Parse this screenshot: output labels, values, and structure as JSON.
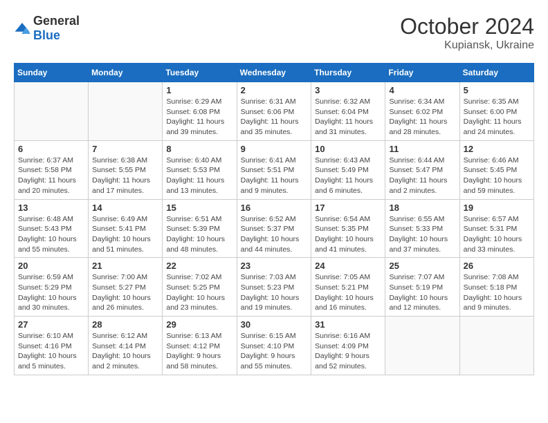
{
  "header": {
    "logo": {
      "general": "General",
      "blue": "Blue"
    },
    "title": "October 2024",
    "location": "Kupiansk, Ukraine"
  },
  "weekdays": [
    "Sunday",
    "Monday",
    "Tuesday",
    "Wednesday",
    "Thursday",
    "Friday",
    "Saturday"
  ],
  "weeks": [
    [
      {
        "day": "",
        "info": ""
      },
      {
        "day": "",
        "info": ""
      },
      {
        "day": "1",
        "info": "Sunrise: 6:29 AM\nSunset: 6:08 PM\nDaylight: 11 hours and 39 minutes."
      },
      {
        "day": "2",
        "info": "Sunrise: 6:31 AM\nSunset: 6:06 PM\nDaylight: 11 hours and 35 minutes."
      },
      {
        "day": "3",
        "info": "Sunrise: 6:32 AM\nSunset: 6:04 PM\nDaylight: 11 hours and 31 minutes."
      },
      {
        "day": "4",
        "info": "Sunrise: 6:34 AM\nSunset: 6:02 PM\nDaylight: 11 hours and 28 minutes."
      },
      {
        "day": "5",
        "info": "Sunrise: 6:35 AM\nSunset: 6:00 PM\nDaylight: 11 hours and 24 minutes."
      }
    ],
    [
      {
        "day": "6",
        "info": "Sunrise: 6:37 AM\nSunset: 5:58 PM\nDaylight: 11 hours and 20 minutes."
      },
      {
        "day": "7",
        "info": "Sunrise: 6:38 AM\nSunset: 5:55 PM\nDaylight: 11 hours and 17 minutes."
      },
      {
        "day": "8",
        "info": "Sunrise: 6:40 AM\nSunset: 5:53 PM\nDaylight: 11 hours and 13 minutes."
      },
      {
        "day": "9",
        "info": "Sunrise: 6:41 AM\nSunset: 5:51 PM\nDaylight: 11 hours and 9 minutes."
      },
      {
        "day": "10",
        "info": "Sunrise: 6:43 AM\nSunset: 5:49 PM\nDaylight: 11 hours and 6 minutes."
      },
      {
        "day": "11",
        "info": "Sunrise: 6:44 AM\nSunset: 5:47 PM\nDaylight: 11 hours and 2 minutes."
      },
      {
        "day": "12",
        "info": "Sunrise: 6:46 AM\nSunset: 5:45 PM\nDaylight: 10 hours and 59 minutes."
      }
    ],
    [
      {
        "day": "13",
        "info": "Sunrise: 6:48 AM\nSunset: 5:43 PM\nDaylight: 10 hours and 55 minutes."
      },
      {
        "day": "14",
        "info": "Sunrise: 6:49 AM\nSunset: 5:41 PM\nDaylight: 10 hours and 51 minutes."
      },
      {
        "day": "15",
        "info": "Sunrise: 6:51 AM\nSunset: 5:39 PM\nDaylight: 10 hours and 48 minutes."
      },
      {
        "day": "16",
        "info": "Sunrise: 6:52 AM\nSunset: 5:37 PM\nDaylight: 10 hours and 44 minutes."
      },
      {
        "day": "17",
        "info": "Sunrise: 6:54 AM\nSunset: 5:35 PM\nDaylight: 10 hours and 41 minutes."
      },
      {
        "day": "18",
        "info": "Sunrise: 6:55 AM\nSunset: 5:33 PM\nDaylight: 10 hours and 37 minutes."
      },
      {
        "day": "19",
        "info": "Sunrise: 6:57 AM\nSunset: 5:31 PM\nDaylight: 10 hours and 33 minutes."
      }
    ],
    [
      {
        "day": "20",
        "info": "Sunrise: 6:59 AM\nSunset: 5:29 PM\nDaylight: 10 hours and 30 minutes."
      },
      {
        "day": "21",
        "info": "Sunrise: 7:00 AM\nSunset: 5:27 PM\nDaylight: 10 hours and 26 minutes."
      },
      {
        "day": "22",
        "info": "Sunrise: 7:02 AM\nSunset: 5:25 PM\nDaylight: 10 hours and 23 minutes."
      },
      {
        "day": "23",
        "info": "Sunrise: 7:03 AM\nSunset: 5:23 PM\nDaylight: 10 hours and 19 minutes."
      },
      {
        "day": "24",
        "info": "Sunrise: 7:05 AM\nSunset: 5:21 PM\nDaylight: 10 hours and 16 minutes."
      },
      {
        "day": "25",
        "info": "Sunrise: 7:07 AM\nSunset: 5:19 PM\nDaylight: 10 hours and 12 minutes."
      },
      {
        "day": "26",
        "info": "Sunrise: 7:08 AM\nSunset: 5:18 PM\nDaylight: 10 hours and 9 minutes."
      }
    ],
    [
      {
        "day": "27",
        "info": "Sunrise: 6:10 AM\nSunset: 4:16 PM\nDaylight: 10 hours and 5 minutes."
      },
      {
        "day": "28",
        "info": "Sunrise: 6:12 AM\nSunset: 4:14 PM\nDaylight: 10 hours and 2 minutes."
      },
      {
        "day": "29",
        "info": "Sunrise: 6:13 AM\nSunset: 4:12 PM\nDaylight: 9 hours and 58 minutes."
      },
      {
        "day": "30",
        "info": "Sunrise: 6:15 AM\nSunset: 4:10 PM\nDaylight: 9 hours and 55 minutes."
      },
      {
        "day": "31",
        "info": "Sunrise: 6:16 AM\nSunset: 4:09 PM\nDaylight: 9 hours and 52 minutes."
      },
      {
        "day": "",
        "info": ""
      },
      {
        "day": "",
        "info": ""
      }
    ]
  ]
}
